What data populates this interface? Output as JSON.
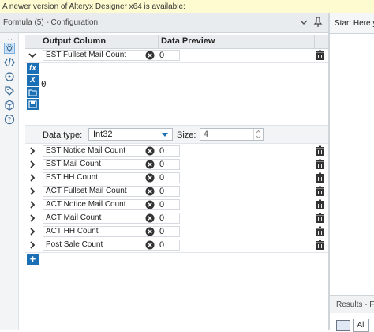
{
  "banner": {
    "text": "A newer version of Alteryx Designer x64 is available:"
  },
  "panel": {
    "title": "Formula (5) - Configuration"
  },
  "right_pane": {
    "tab_title": "Start Here.y",
    "results_title": "Results - For",
    "all_label": "All"
  },
  "toolbar": {
    "icons": [
      "gear-icon",
      "code-icon",
      "refresh-icon",
      "tag-icon",
      "cube-icon",
      "help-icon"
    ]
  },
  "grid": {
    "col_output": "Output Column",
    "col_preview": "Data Preview",
    "rows": [
      {
        "name": "EST Fullset Mail Count",
        "preview": "0",
        "expanded": true
      },
      {
        "name": "EST Notice Mail Count",
        "preview": "0"
      },
      {
        "name": "EST Mail Count",
        "preview": "0"
      },
      {
        "name": "EST HH Count",
        "preview": "0"
      },
      {
        "name": "ACT Fullset Mail Count",
        "preview": "0"
      },
      {
        "name": "ACT Notice Mail Count",
        "preview": "0"
      },
      {
        "name": "ACT Mail Count",
        "preview": "0"
      },
      {
        "name": "ACT HH Count",
        "preview": "0"
      },
      {
        "name": "Post Sale Count",
        "preview": "0"
      }
    ]
  },
  "editor": {
    "expression": "0",
    "icons": {
      "fx": "fx",
      "x": "X"
    },
    "data_type_label": "Data type:",
    "data_type_value": "Int32",
    "size_label": "Size:",
    "size_value": "4"
  },
  "colors": {
    "accent": "#1a6fb5",
    "banner_bg": "#fffbd0"
  }
}
